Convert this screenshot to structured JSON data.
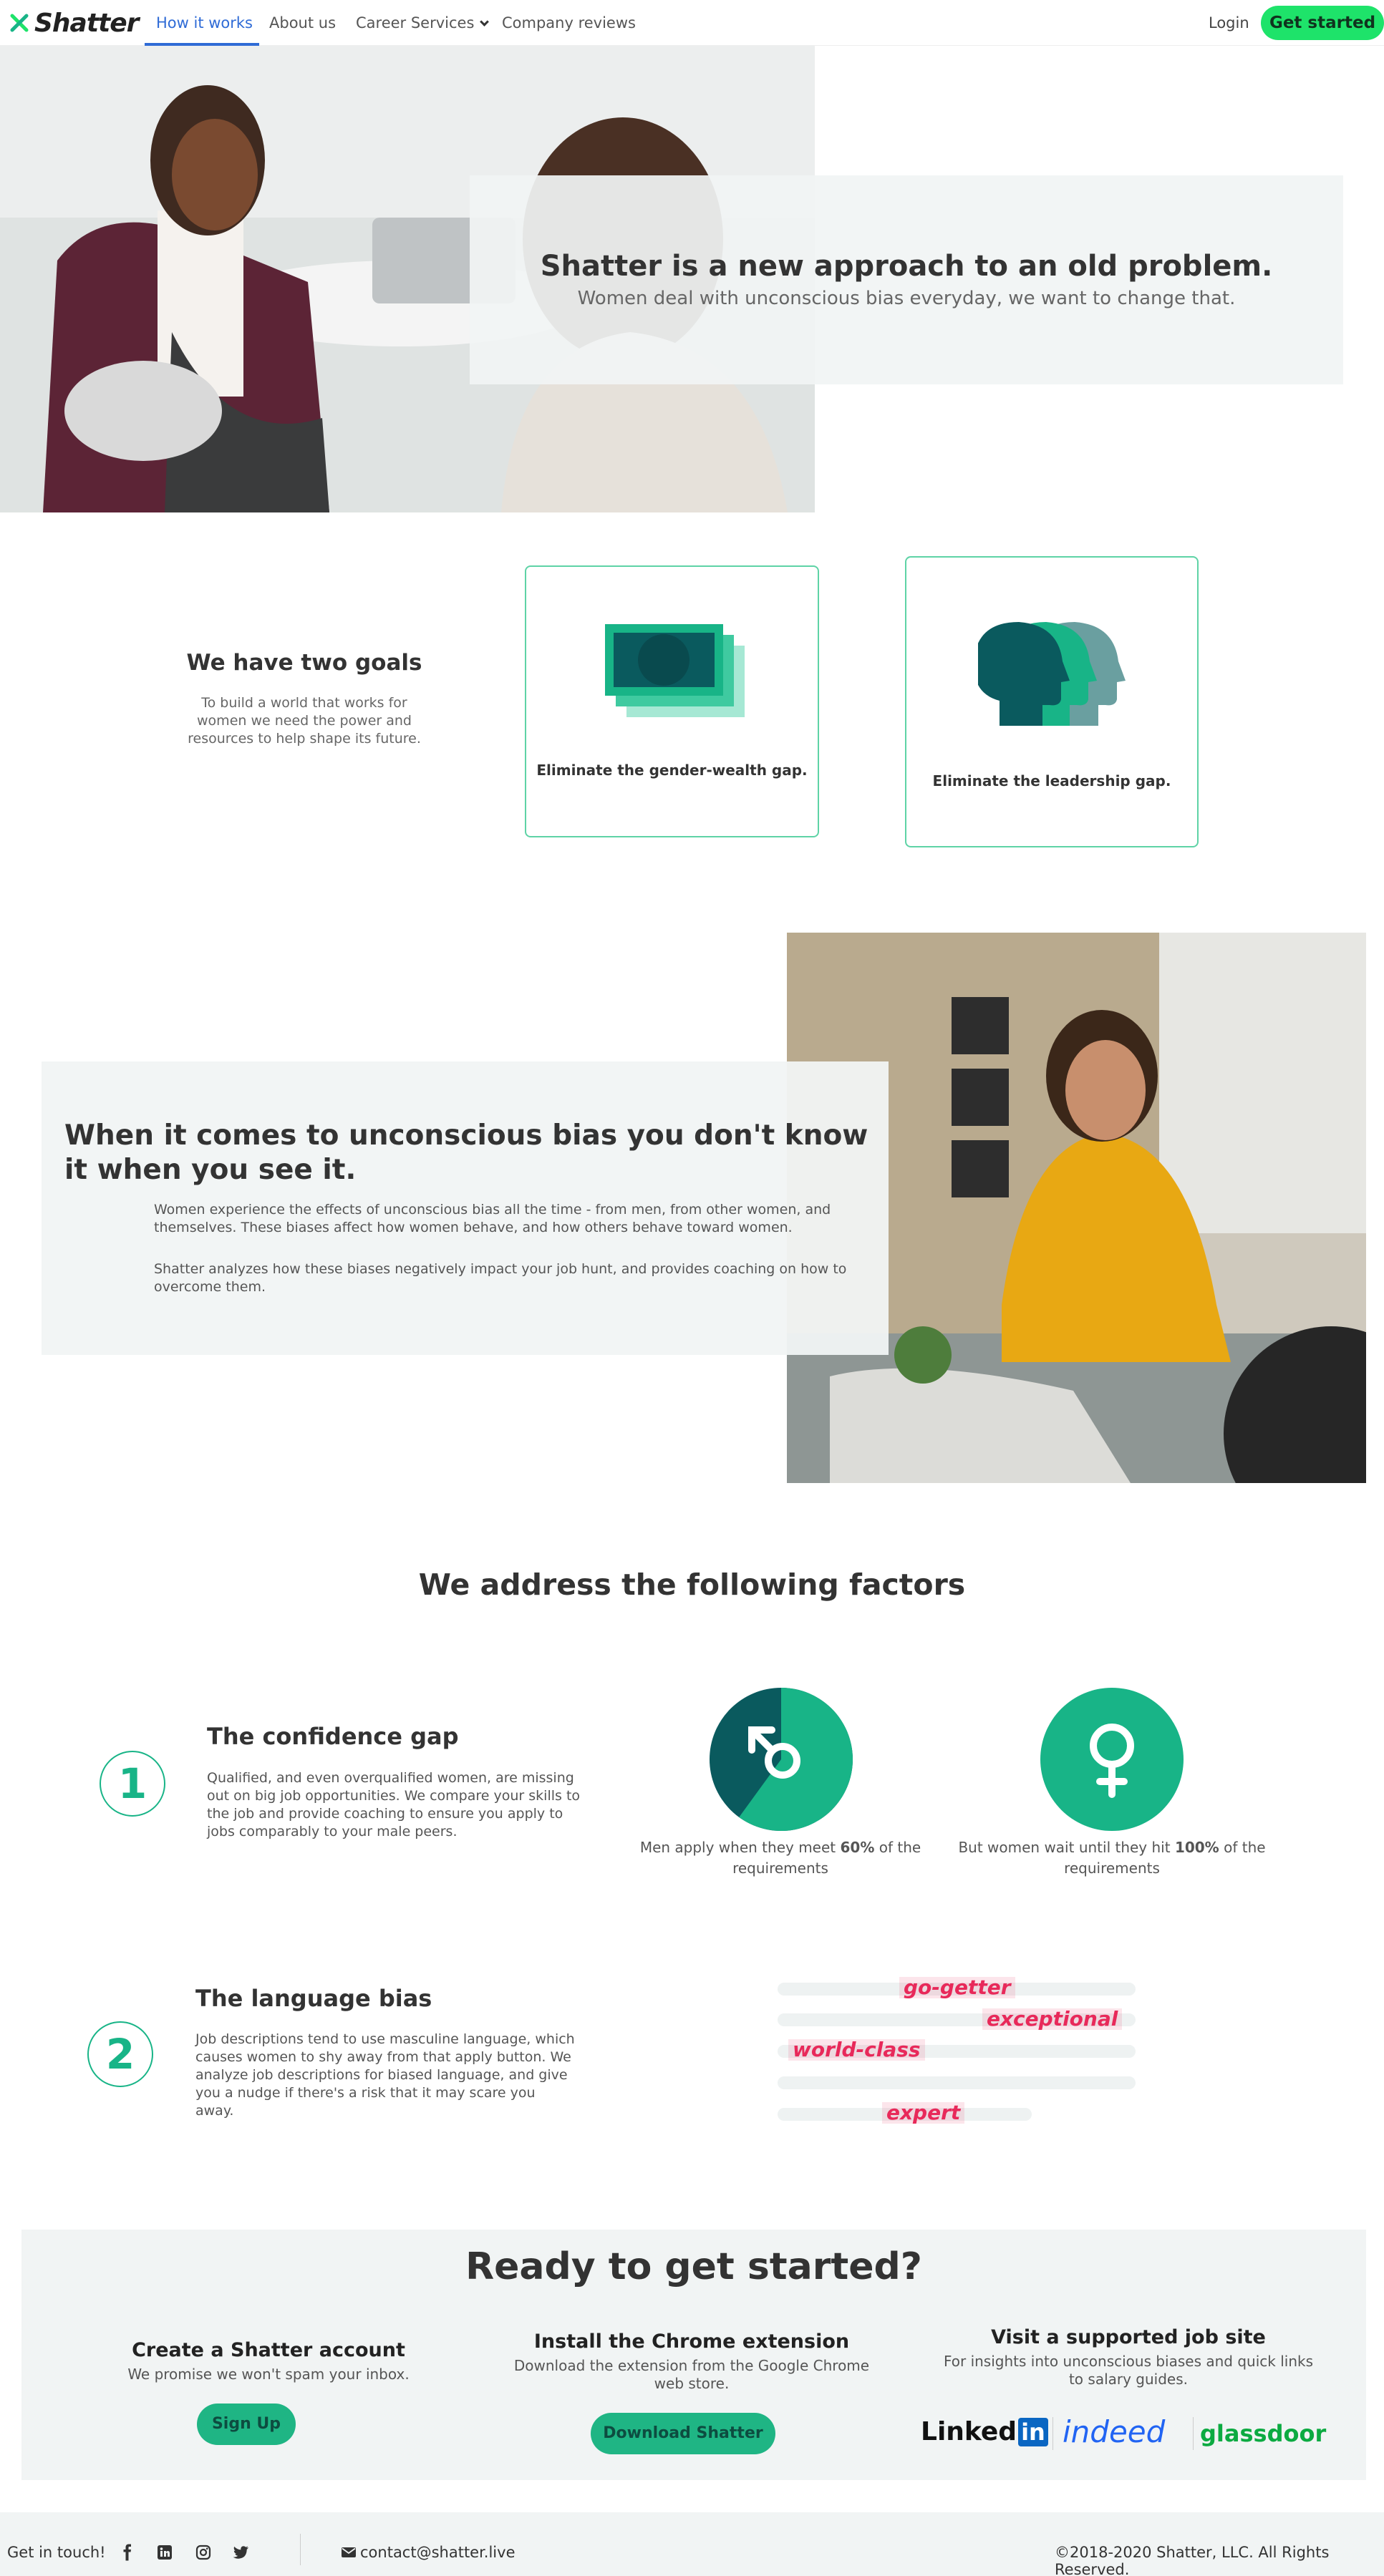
{
  "nav": {
    "logo_text": "Shatter",
    "links": [
      "How it works",
      "About us",
      "Career Services",
      "Company reviews"
    ],
    "login": "Login",
    "cta": "Get started"
  },
  "hero": {
    "title": "Shatter is a new approach to an old problem.",
    "subtitle": "Women deal with unconscious bias everyday, we want to change that."
  },
  "goals": {
    "heading": "We have two goals",
    "text": "To build a world that works for women we need the power and resources to help shape its future.",
    "cards": [
      {
        "label": "Eliminate the gender-wealth gap.",
        "icon": "money-icon"
      },
      {
        "label": "Eliminate the leadership gap.",
        "icon": "heads-icon"
      }
    ]
  },
  "bias": {
    "heading": "When it comes to unconscious bias you don't know it when you see it.",
    "p1": "Women experience the effects of unconscious bias all the time - from men, from other women, and themselves. These biases affect how women behave, and how others behave toward women.",
    "p2": "Shatter analyzes how these biases negatively impact your job hunt, and provides coaching on how to overcome them."
  },
  "factors": {
    "heading": "We address the following factors",
    "confidence": {
      "number": "1",
      "title": "The confidence gap",
      "text": "Qualified, and even overqualified women, are missing out on big job opportunities. We compare your skills to the job and provide coaching to ensure you apply to jobs comparably to your male peers.",
      "men_prefix": "Men apply when they meet ",
      "men_value": "60%",
      "men_suffix": " of the requirements",
      "women_prefix": "But women wait until they hit ",
      "women_value": "100%",
      "women_suffix": " of the requirements",
      "men_fraction": 0.6,
      "women_fraction": 1.0
    },
    "language": {
      "number": "2",
      "title": "The language bias",
      "text": "Job descriptions tend to use masculine language, which causes women to shy away from that apply button. We analyze job descriptions for biased language, and give you a nudge if there's a risk that it may scare you away.",
      "words": [
        "go-getter",
        "exceptional",
        "world-class",
        "expert"
      ]
    }
  },
  "ready": {
    "heading": "Ready to get started?",
    "col1": {
      "title": "Create a Shatter account",
      "text": "We promise we won't spam your inbox.",
      "button": "Sign Up"
    },
    "col2": {
      "title": "Install the Chrome extension",
      "text": "Download the extension from the Google Chrome web store.",
      "button": "Download Shatter"
    },
    "col3": {
      "title": "Visit a supported job site",
      "text": "For insights into unconscious biases and quick links to salary guides.",
      "brands": [
        "Linked",
        "in",
        "indeed",
        "glassdoor"
      ]
    }
  },
  "footer": {
    "get_in_touch": "Get in touch!",
    "email": "contact@shatter.live",
    "copyright": "©2018-2020 Shatter, LLC. All Rights Reserved."
  },
  "colors": {
    "accent": "#1ee36a",
    "teal": "#18b487",
    "dark_teal": "#0a5a5e",
    "link": "#2f6bd6",
    "bias_word": "#e8295a"
  }
}
